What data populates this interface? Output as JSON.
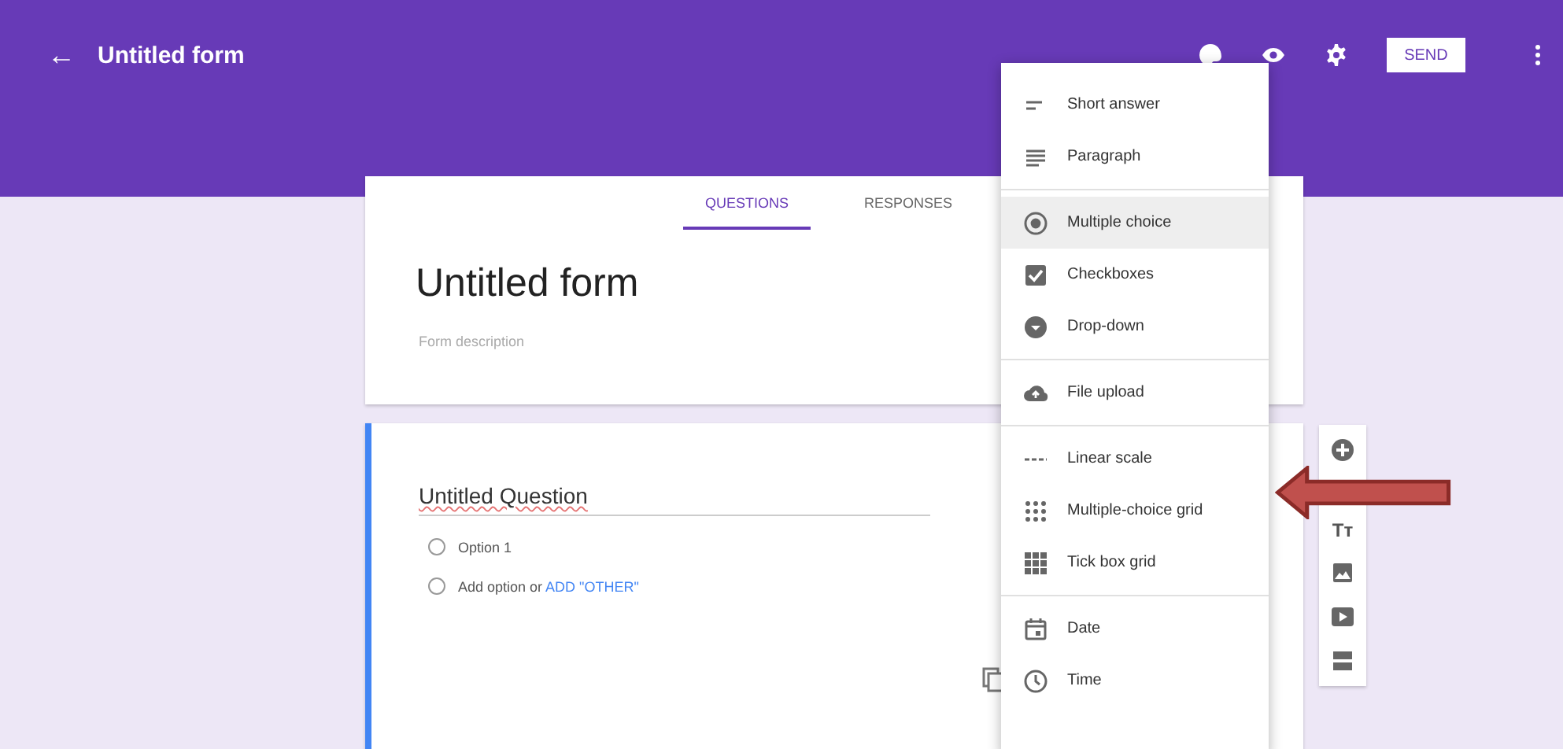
{
  "header": {
    "back_icon": "←",
    "title": "Untitled form",
    "send_button": "SEND"
  },
  "tabs": [
    {
      "label": "QUESTIONS",
      "selected": true
    },
    {
      "label": "RESPONSES",
      "selected": false
    }
  ],
  "form": {
    "title": "Untitled form",
    "description_placeholder": "Form description"
  },
  "question": {
    "title": "Untitled Question",
    "options": [
      {
        "label": "Option 1",
        "selected": false
      }
    ],
    "add_option_selected": false,
    "add_option": "Add option",
    "or": "or",
    "add_other": "ADD \"OTHER\""
  },
  "menu": {
    "groups": [
      [
        {
          "label": "Short answer",
          "selected": false
        },
        {
          "label": "Paragraph",
          "selected": false
        }
      ],
      [
        {
          "label": "Multiple choice",
          "selected": true
        },
        {
          "label": "Checkboxes",
          "selected": false
        },
        {
          "label": "Drop-down",
          "selected": false
        }
      ],
      [
        {
          "label": "File upload",
          "selected": false
        }
      ],
      [
        {
          "label": "Linear scale",
          "selected": false
        },
        {
          "label": "Multiple-choice grid",
          "selected": false
        },
        {
          "label": "Tick box grid",
          "selected": false
        }
      ],
      [
        {
          "label": "Date",
          "selected": false
        },
        {
          "label": "Time",
          "selected": false
        }
      ]
    ]
  },
  "side_toolbar": {
    "text_tool": "Tт"
  }
}
